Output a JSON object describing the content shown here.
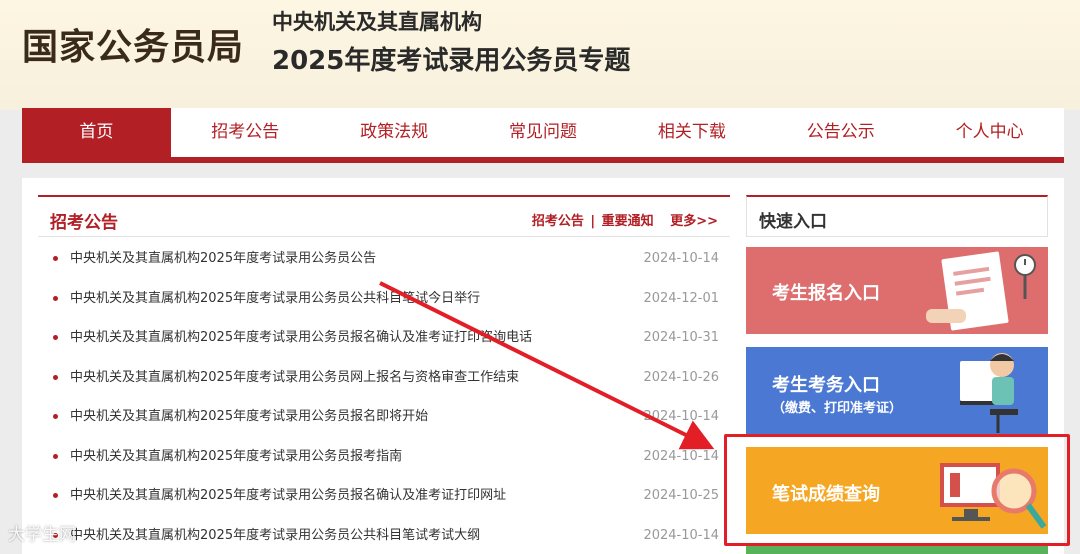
{
  "header": {
    "logo": "国家公务员局",
    "sub1": "中央机关及其直属机构",
    "sub2": "2025年度考试录用公务员专题"
  },
  "nav": [
    "首页",
    "招考公告",
    "政策法规",
    "常见问题",
    "相关下载",
    "公告公示",
    "个人中心"
  ],
  "news": {
    "title": "招考公告",
    "links": [
      "招考公告",
      "|",
      "重要通知",
      "更多>>"
    ],
    "items": [
      {
        "text": "中央机关及其直属机构2025年度考试录用公务员公告",
        "date": "2024-10-14"
      },
      {
        "text": "中央机关及其直属机构2025年度考试录用公务员公共科目笔试今日举行",
        "date": "2024-12-01"
      },
      {
        "text": "中央机关及其直属机构2025年度考试录用公务员报名确认及准考证打印咨询电话",
        "date": "2024-10-31"
      },
      {
        "text": "中央机关及其直属机构2025年度考试录用公务员网上报名与资格审查工作结束",
        "date": "2024-10-26"
      },
      {
        "text": "中央机关及其直属机构2025年度考试录用公务员报名即将开始",
        "date": "2024-10-14"
      },
      {
        "text": "中央机关及其直属机构2025年度考试录用公务员报考指南",
        "date": "2024-10-14"
      },
      {
        "text": "中央机关及其直属机构2025年度考试录用公务员报名确认及准考证打印网址",
        "date": "2024-10-25"
      },
      {
        "text": "中央机关及其直属机构2025年度考试录用公务员公共科目笔试考试大纲",
        "date": "2024-10-14"
      }
    ]
  },
  "quick": {
    "title": "快速入口",
    "cards": [
      {
        "title": "考生报名入口",
        "sub": ""
      },
      {
        "title": "考生考务入口",
        "sub": "（缴费、打印准考证）"
      },
      {
        "title": "笔试成绩查询",
        "sub": ""
      }
    ]
  },
  "watermark": "大学生网",
  "colors": {
    "accent": "#b21f24",
    "highlight": "#e21e26",
    "card1": "#de6e6e",
    "card2": "#4a78d3",
    "card3": "#f5a623"
  }
}
